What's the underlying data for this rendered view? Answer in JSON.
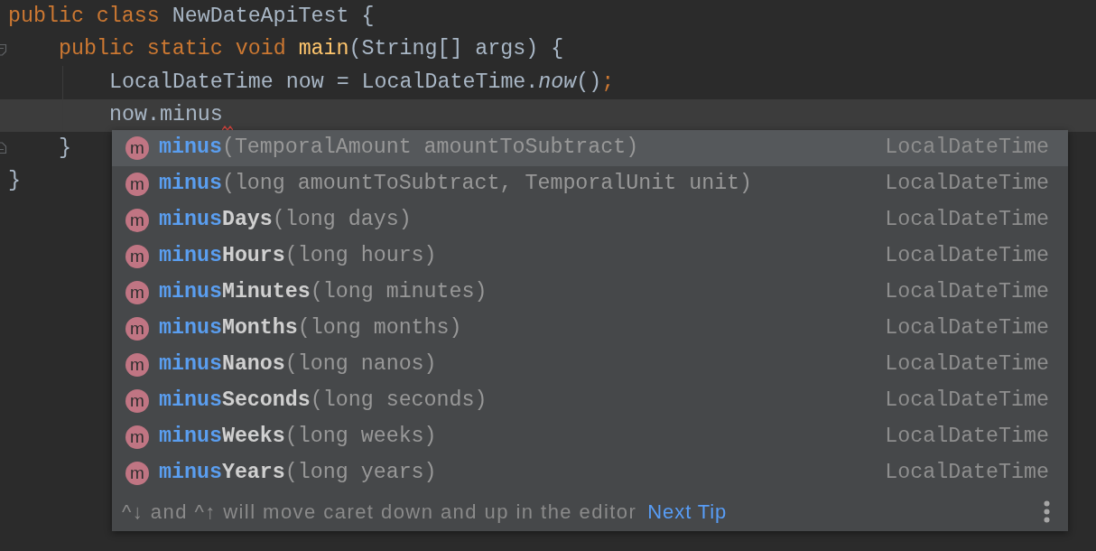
{
  "code": [
    {
      "tokens": [
        {
          "text": "public class ",
          "kind": "keyword"
        },
        {
          "text": "NewDateApiTest {",
          "kind": "plain"
        }
      ],
      "current": false,
      "error": false,
      "fold_markers": false,
      "closing": "}",
      "children": [
        {
          "tokens": [
            {
              "text": "public static void ",
              "kind": "keyword"
            },
            {
              "text": "main",
              "kind": "declaration"
            },
            {
              "text": "(String[] args) {",
              "kind": "plain"
            }
          ],
          "current": false,
          "error": false,
          "fold_markers": true,
          "closing": "}",
          "children": [
            {
              "tokens": [
                {
                  "text": "LocalDateTime now = LocalDateTime.",
                  "kind": "plain"
                },
                {
                  "text": "now",
                  "kind": "static_call"
                },
                {
                  "text": "()",
                  "kind": "plain"
                },
                {
                  "text": ";",
                  "kind": "punctuation"
                }
              ],
              "current": false,
              "error": false,
              "fold_markers": false
            },
            {
              "tokens": [
                {
                  "text": "now.minus",
                  "kind": "plain"
                }
              ],
              "current": true,
              "error": true,
              "fold_markers": false
            }
          ]
        }
      ]
    }
  ],
  "completion_popup": {
    "items": [
      {
        "icon": "m",
        "match": "minus",
        "params": "(TemporalAmount amountToSubtract)",
        "type": "LocalDateTime",
        "selected": true
      },
      {
        "icon": "m",
        "match": "minus",
        "params": "(long amountToSubtract, TemporalUnit unit)",
        "type": "LocalDateTime",
        "selected": false
      },
      {
        "icon": "m",
        "match": "minus",
        "rest": "Days",
        "params": "(long days)",
        "type": "LocalDateTime",
        "selected": false
      },
      {
        "icon": "m",
        "match": "minus",
        "rest": "Hours",
        "params": "(long hours)",
        "type": "LocalDateTime",
        "selected": false
      },
      {
        "icon": "m",
        "match": "minus",
        "rest": "Minutes",
        "params": "(long minutes)",
        "type": "LocalDateTime",
        "selected": false
      },
      {
        "icon": "m",
        "match": "minus",
        "rest": "Months",
        "params": "(long months)",
        "type": "LocalDateTime",
        "selected": false
      },
      {
        "icon": "m",
        "match": "minus",
        "rest": "Nanos",
        "params": "(long nanos)",
        "type": "LocalDateTime",
        "selected": false
      },
      {
        "icon": "m",
        "match": "minus",
        "rest": "Seconds",
        "params": "(long seconds)",
        "type": "LocalDateTime",
        "selected": false
      },
      {
        "icon": "m",
        "match": "minus",
        "rest": "Weeks",
        "params": "(long weeks)",
        "type": "LocalDateTime",
        "selected": false
      },
      {
        "icon": "m",
        "match": "minus",
        "rest": "Years",
        "params": "(long years)",
        "type": "LocalDateTime",
        "selected": false
      }
    ],
    "tip": {
      "text": "^↓ and ^↑ will move caret down and up in the editor",
      "link": "Next Tip"
    }
  }
}
